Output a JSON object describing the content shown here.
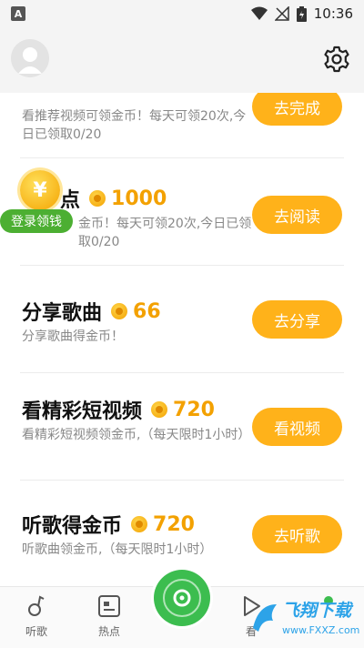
{
  "status_bar": {
    "indicator": "A",
    "time": "10:36"
  },
  "header": {
    "avatar_icon": "avatar-icon",
    "settings_icon": "gear-icon"
  },
  "tasks": [
    {
      "title": "",
      "reward": "",
      "desc": "看推荐视频可领金币！每天可领20次,今日已领取0/20",
      "button": "去完成"
    },
    {
      "title": "点",
      "reward": "1000",
      "desc": "金币！每天可领20次,今日已领取0/20",
      "button": "去阅读"
    },
    {
      "title": "分享歌曲",
      "reward": "66",
      "desc": "分享歌曲得金币！",
      "button": "去分享"
    },
    {
      "title": "看精彩短视频",
      "reward": "720",
      "desc": "看精彩短视频领金币,（每天限时1小时）",
      "button": "看视频"
    },
    {
      "title": "听歌得金币",
      "reward": "720",
      "desc": "听歌曲领金币,（每天限时1小时）",
      "button": "去听歌"
    }
  ],
  "float_coin": {
    "symbol": "¥",
    "badge": "登录领钱"
  },
  "bottom_nav": {
    "items": [
      {
        "label": "听歌",
        "icon": "music-note-icon"
      },
      {
        "label": "热点",
        "icon": "news-icon"
      },
      {
        "label": "看",
        "icon": "video-icon"
      }
    ]
  },
  "watermark": {
    "title": "飞翔下载",
    "url": "www.FXXZ.com"
  },
  "colors": {
    "accent": "#ffb21a",
    "reward": "#f3a100",
    "green": "#3cbd4f",
    "badge": "#4caf32"
  }
}
